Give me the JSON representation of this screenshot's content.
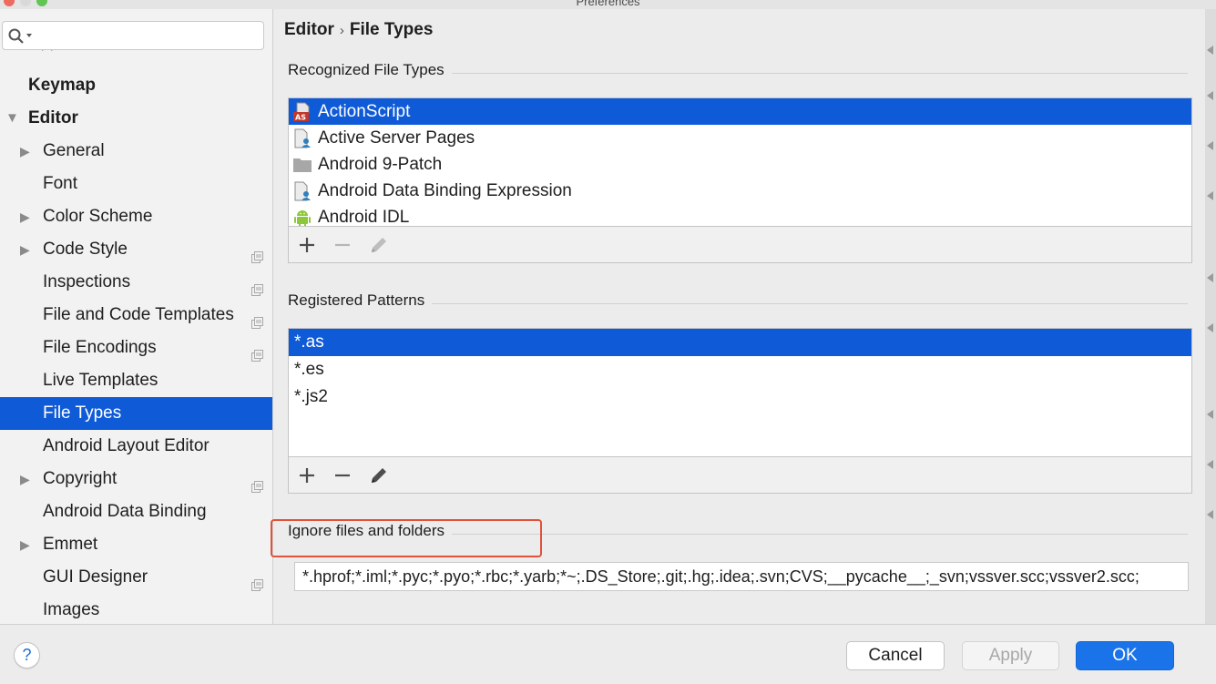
{
  "window": {
    "title": "Preferences"
  },
  "search": {
    "value": "",
    "placeholder": ""
  },
  "sidebar": {
    "items": [
      {
        "label": "Keymap",
        "level": 0,
        "expandable": false,
        "has_settings_icon": false,
        "selected": false
      },
      {
        "label": "Editor",
        "level": 0,
        "expandable": true,
        "expanded": true,
        "has_settings_icon": false,
        "selected": false
      },
      {
        "label": "General",
        "level": 1,
        "expandable": true,
        "has_settings_icon": false,
        "selected": false
      },
      {
        "label": "Font",
        "level": 1,
        "expandable": false,
        "has_settings_icon": false,
        "selected": false
      },
      {
        "label": "Color Scheme",
        "level": 1,
        "expandable": true,
        "has_settings_icon": false,
        "selected": false
      },
      {
        "label": "Code Style",
        "level": 1,
        "expandable": true,
        "has_settings_icon": true,
        "selected": false
      },
      {
        "label": "Inspections",
        "level": 1,
        "expandable": false,
        "has_settings_icon": true,
        "selected": false
      },
      {
        "label": "File and Code Templates",
        "level": 1,
        "expandable": false,
        "has_settings_icon": true,
        "selected": false
      },
      {
        "label": "File Encodings",
        "level": 1,
        "expandable": false,
        "has_settings_icon": true,
        "selected": false
      },
      {
        "label": "Live Templates",
        "level": 1,
        "expandable": false,
        "has_settings_icon": false,
        "selected": false
      },
      {
        "label": "File Types",
        "level": 1,
        "expandable": false,
        "has_settings_icon": false,
        "selected": true
      },
      {
        "label": "Android Layout Editor",
        "level": 1,
        "expandable": false,
        "has_settings_icon": false,
        "selected": false
      },
      {
        "label": "Copyright",
        "level": 1,
        "expandable": true,
        "has_settings_icon": true,
        "selected": false
      },
      {
        "label": "Android Data Binding",
        "level": 1,
        "expandable": false,
        "has_settings_icon": false,
        "selected": false
      },
      {
        "label": "Emmet",
        "level": 1,
        "expandable": true,
        "has_settings_icon": false,
        "selected": false
      },
      {
        "label": "GUI Designer",
        "level": 1,
        "expandable": false,
        "has_settings_icon": true,
        "selected": false
      },
      {
        "label": "Images",
        "level": 1,
        "expandable": false,
        "has_settings_icon": false,
        "selected": false
      }
    ]
  },
  "breadcrumb": {
    "parent": "Editor",
    "separator": "›",
    "current": "File Types"
  },
  "recognized": {
    "title": "Recognized File Types",
    "items": [
      {
        "label": "ActionScript",
        "icon": "actionscript-file-icon",
        "selected": true
      },
      {
        "label": "Active Server Pages",
        "icon": "asp-file-icon",
        "selected": false
      },
      {
        "label": "Android 9-Patch",
        "icon": "folder-icon",
        "selected": false
      },
      {
        "label": "Android Data Binding Expression",
        "icon": "data-binding-file-icon",
        "selected": false
      },
      {
        "label": "Android IDL",
        "icon": "android-icon",
        "selected": false
      }
    ]
  },
  "patterns": {
    "title": "Registered Patterns",
    "items": [
      {
        "label": "*.as",
        "selected": true
      },
      {
        "label": "*.es",
        "selected": false
      },
      {
        "label": "*.js2",
        "selected": false
      }
    ]
  },
  "ignore": {
    "title": "Ignore files and folders",
    "value": "*.hprof;*.iml;*.pyc;*.pyo;*.rbc;*.yarb;*~;.DS_Store;.git;.hg;.idea;.svn;CVS;__pycache__;_svn;vssver.scc;vssver2.scc;"
  },
  "buttons": {
    "help": "?",
    "cancel": "Cancel",
    "apply": "Apply",
    "ok": "OK"
  },
  "colors": {
    "selection": "#0f5ad7",
    "ok_button": "#1a73e8",
    "highlight_box": "#e0523a"
  }
}
